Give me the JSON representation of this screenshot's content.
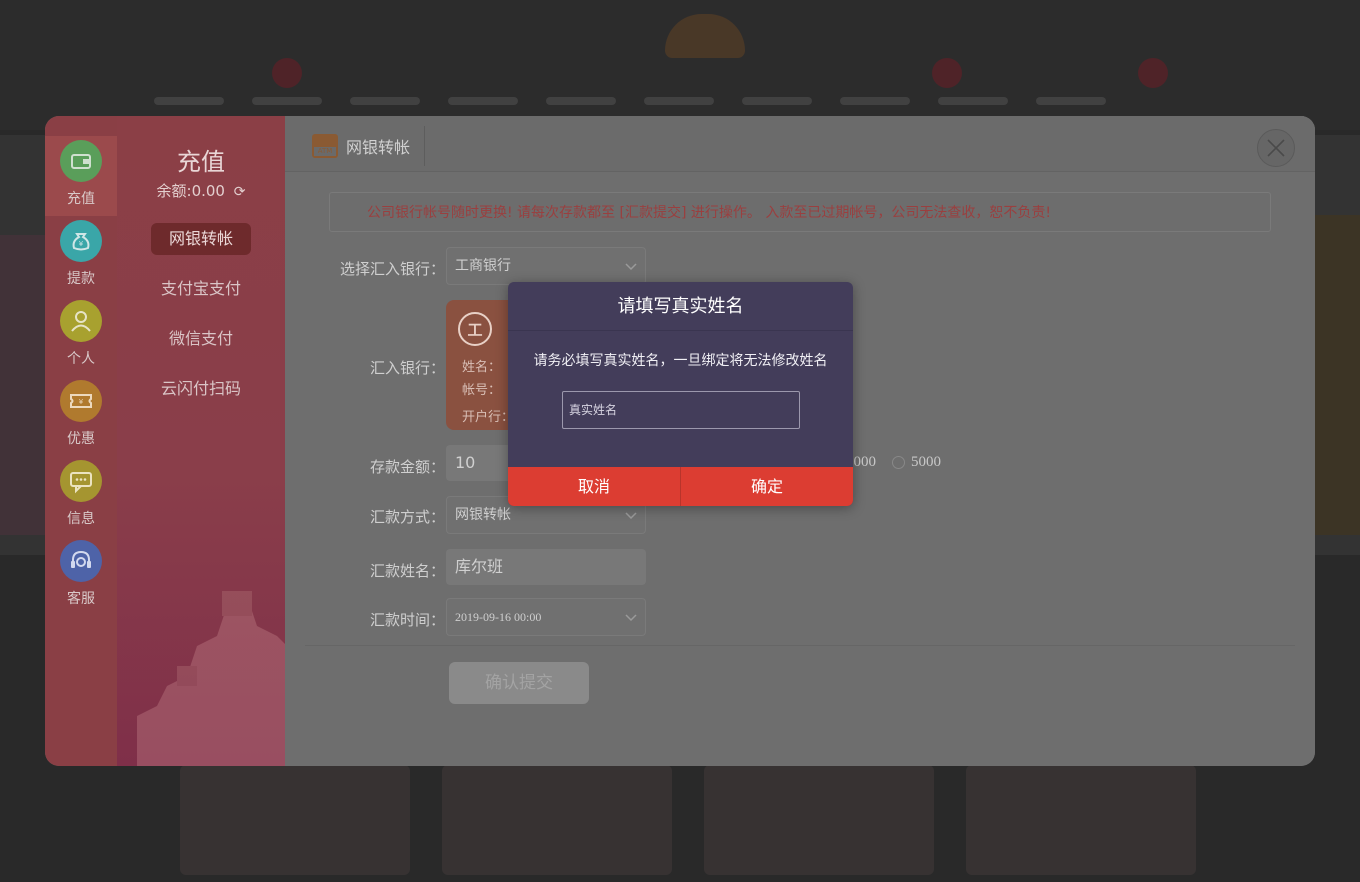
{
  "rail": [
    {
      "label": "充值",
      "icon": "wallet-icon",
      "color": "#5a9e5a",
      "active": true
    },
    {
      "label": "提款",
      "icon": "money-bag-icon",
      "color": "#3aa6a8"
    },
    {
      "label": "个人",
      "icon": "user-icon",
      "color": "#a8a12f"
    },
    {
      "label": "优惠",
      "icon": "coupon-icon",
      "color": "#b07a2e"
    },
    {
      "label": "信息",
      "icon": "message-icon",
      "color": "#a59530"
    },
    {
      "label": "客服",
      "icon": "headset-icon",
      "color": "#4e63a8"
    }
  ],
  "submenu": {
    "title": "充值",
    "balance": "余额:0.00",
    "items": [
      {
        "label": "网银转帐",
        "active": true
      },
      {
        "label": "支付宝支付"
      },
      {
        "label": "微信支付"
      },
      {
        "label": "云闪付扫码"
      }
    ]
  },
  "tab": {
    "label": "网银转帐",
    "icon_text": "ATM"
  },
  "notice": "公司银行帐号随时更换! 请每次存款都至 [汇款提交] 进行操作。 入款至已过期帐号，公司无法查收，恕不负责!",
  "form": {
    "select_bank_label": "选择汇入银行：",
    "select_bank_value": "工商银行",
    "deposit_bank_label": "汇入银行：",
    "bank_card": {
      "logo_text": "工",
      "name_label": "姓名：",
      "account_label": "帐号：",
      "branch_label": "开户行："
    },
    "amount_label": "存款金额：",
    "amount_value": "10",
    "amount_options": [
      "1000",
      "5000"
    ],
    "method_label": "汇款方式：",
    "method_value": "网银转帐",
    "name_label": "汇款姓名：",
    "name_value": "库尔班",
    "time_label": "汇款时间：",
    "time_value": "2019-09-16 00:00",
    "submit": "确认提交"
  },
  "dialog": {
    "title": "请填写真实姓名",
    "message": "请务必填写真实姓名，一旦绑定将无法修改姓名",
    "placeholder": "真实姓名",
    "cancel": "取消",
    "confirm": "确定"
  }
}
